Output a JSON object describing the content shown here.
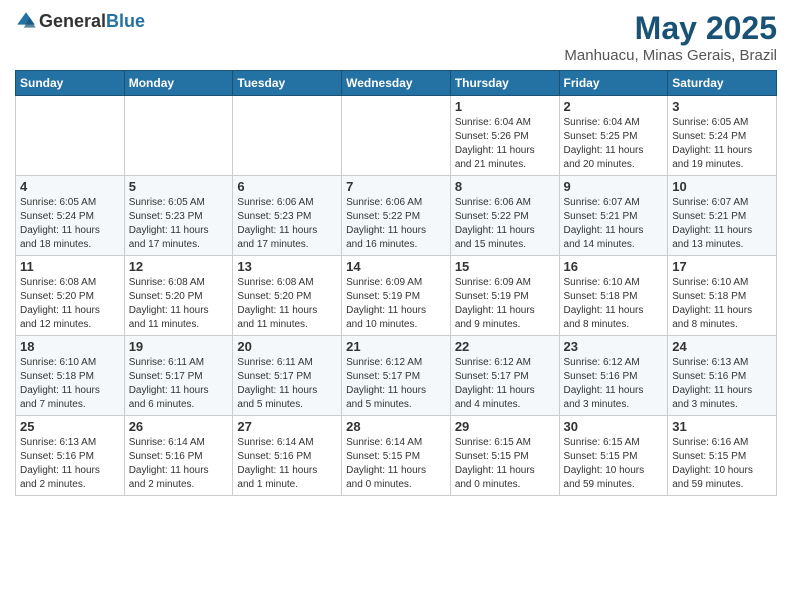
{
  "header": {
    "logo_general": "General",
    "logo_blue": "Blue",
    "month_title": "May 2025",
    "location": "Manhuacu, Minas Gerais, Brazil"
  },
  "weekdays": [
    "Sunday",
    "Monday",
    "Tuesday",
    "Wednesday",
    "Thursday",
    "Friday",
    "Saturday"
  ],
  "weeks": [
    [
      {
        "day": "",
        "info": ""
      },
      {
        "day": "",
        "info": ""
      },
      {
        "day": "",
        "info": ""
      },
      {
        "day": "",
        "info": ""
      },
      {
        "day": "1",
        "info": "Sunrise: 6:04 AM\nSunset: 5:26 PM\nDaylight: 11 hours\nand 21 minutes."
      },
      {
        "day": "2",
        "info": "Sunrise: 6:04 AM\nSunset: 5:25 PM\nDaylight: 11 hours\nand 20 minutes."
      },
      {
        "day": "3",
        "info": "Sunrise: 6:05 AM\nSunset: 5:24 PM\nDaylight: 11 hours\nand 19 minutes."
      }
    ],
    [
      {
        "day": "4",
        "info": "Sunrise: 6:05 AM\nSunset: 5:24 PM\nDaylight: 11 hours\nand 18 minutes."
      },
      {
        "day": "5",
        "info": "Sunrise: 6:05 AM\nSunset: 5:23 PM\nDaylight: 11 hours\nand 17 minutes."
      },
      {
        "day": "6",
        "info": "Sunrise: 6:06 AM\nSunset: 5:23 PM\nDaylight: 11 hours\nand 17 minutes."
      },
      {
        "day": "7",
        "info": "Sunrise: 6:06 AM\nSunset: 5:22 PM\nDaylight: 11 hours\nand 16 minutes."
      },
      {
        "day": "8",
        "info": "Sunrise: 6:06 AM\nSunset: 5:22 PM\nDaylight: 11 hours\nand 15 minutes."
      },
      {
        "day": "9",
        "info": "Sunrise: 6:07 AM\nSunset: 5:21 PM\nDaylight: 11 hours\nand 14 minutes."
      },
      {
        "day": "10",
        "info": "Sunrise: 6:07 AM\nSunset: 5:21 PM\nDaylight: 11 hours\nand 13 minutes."
      }
    ],
    [
      {
        "day": "11",
        "info": "Sunrise: 6:08 AM\nSunset: 5:20 PM\nDaylight: 11 hours\nand 12 minutes."
      },
      {
        "day": "12",
        "info": "Sunrise: 6:08 AM\nSunset: 5:20 PM\nDaylight: 11 hours\nand 11 minutes."
      },
      {
        "day": "13",
        "info": "Sunrise: 6:08 AM\nSunset: 5:20 PM\nDaylight: 11 hours\nand 11 minutes."
      },
      {
        "day": "14",
        "info": "Sunrise: 6:09 AM\nSunset: 5:19 PM\nDaylight: 11 hours\nand 10 minutes."
      },
      {
        "day": "15",
        "info": "Sunrise: 6:09 AM\nSunset: 5:19 PM\nDaylight: 11 hours\nand 9 minutes."
      },
      {
        "day": "16",
        "info": "Sunrise: 6:10 AM\nSunset: 5:18 PM\nDaylight: 11 hours\nand 8 minutes."
      },
      {
        "day": "17",
        "info": "Sunrise: 6:10 AM\nSunset: 5:18 PM\nDaylight: 11 hours\nand 8 minutes."
      }
    ],
    [
      {
        "day": "18",
        "info": "Sunrise: 6:10 AM\nSunset: 5:18 PM\nDaylight: 11 hours\nand 7 minutes."
      },
      {
        "day": "19",
        "info": "Sunrise: 6:11 AM\nSunset: 5:17 PM\nDaylight: 11 hours\nand 6 minutes."
      },
      {
        "day": "20",
        "info": "Sunrise: 6:11 AM\nSunset: 5:17 PM\nDaylight: 11 hours\nand 5 minutes."
      },
      {
        "day": "21",
        "info": "Sunrise: 6:12 AM\nSunset: 5:17 PM\nDaylight: 11 hours\nand 5 minutes."
      },
      {
        "day": "22",
        "info": "Sunrise: 6:12 AM\nSunset: 5:17 PM\nDaylight: 11 hours\nand 4 minutes."
      },
      {
        "day": "23",
        "info": "Sunrise: 6:12 AM\nSunset: 5:16 PM\nDaylight: 11 hours\nand 3 minutes."
      },
      {
        "day": "24",
        "info": "Sunrise: 6:13 AM\nSunset: 5:16 PM\nDaylight: 11 hours\nand 3 minutes."
      }
    ],
    [
      {
        "day": "25",
        "info": "Sunrise: 6:13 AM\nSunset: 5:16 PM\nDaylight: 11 hours\nand 2 minutes."
      },
      {
        "day": "26",
        "info": "Sunrise: 6:14 AM\nSunset: 5:16 PM\nDaylight: 11 hours\nand 2 minutes."
      },
      {
        "day": "27",
        "info": "Sunrise: 6:14 AM\nSunset: 5:16 PM\nDaylight: 11 hours\nand 1 minute."
      },
      {
        "day": "28",
        "info": "Sunrise: 6:14 AM\nSunset: 5:15 PM\nDaylight: 11 hours\nand 0 minutes."
      },
      {
        "day": "29",
        "info": "Sunrise: 6:15 AM\nSunset: 5:15 PM\nDaylight: 11 hours\nand 0 minutes."
      },
      {
        "day": "30",
        "info": "Sunrise: 6:15 AM\nSunset: 5:15 PM\nDaylight: 10 hours\nand 59 minutes."
      },
      {
        "day": "31",
        "info": "Sunrise: 6:16 AM\nSunset: 5:15 PM\nDaylight: 10 hours\nand 59 minutes."
      }
    ]
  ]
}
